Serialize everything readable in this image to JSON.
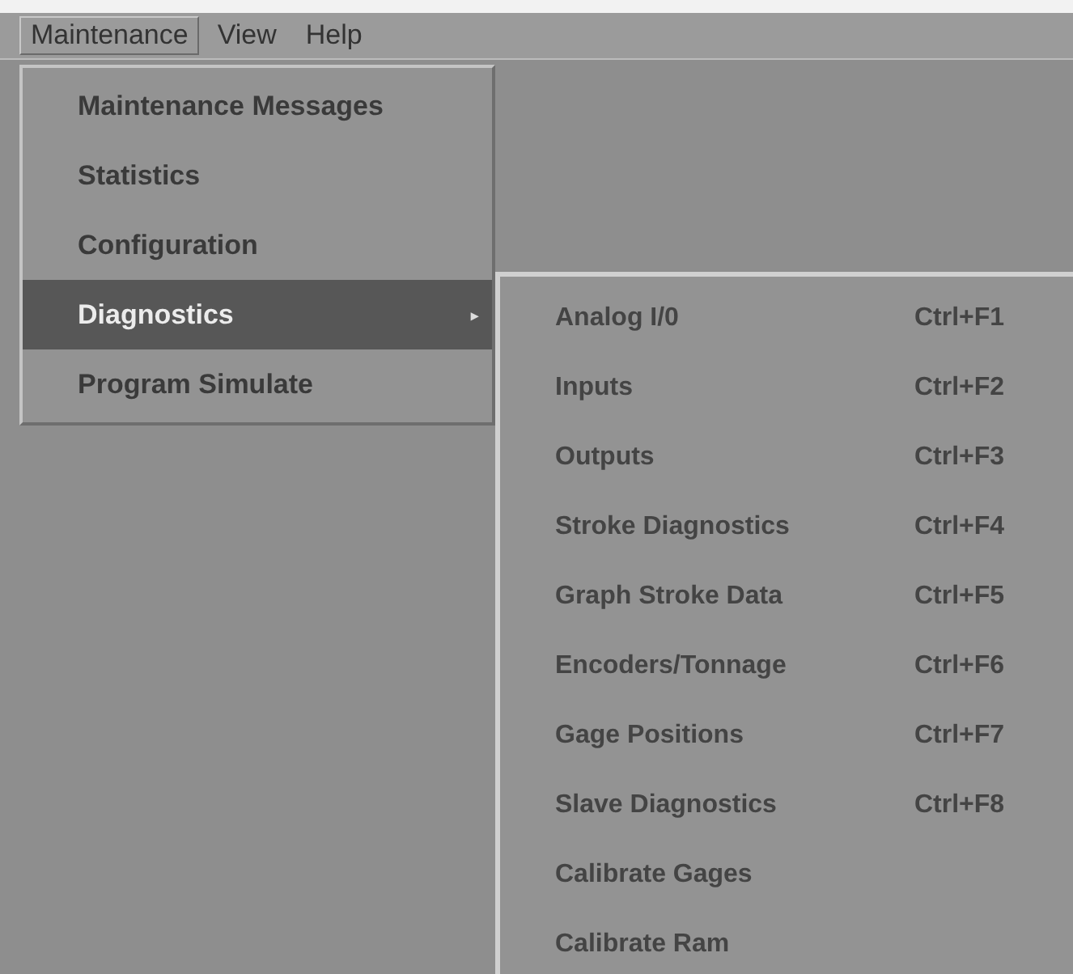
{
  "menubar": [
    {
      "label": "Maintenance",
      "selected": true
    },
    {
      "label": "View",
      "selected": false
    },
    {
      "label": "Help",
      "selected": false
    }
  ],
  "menu": [
    {
      "label": "Maintenance Messages",
      "selected": false
    },
    {
      "label": "Statistics",
      "selected": false
    },
    {
      "label": "Configuration",
      "selected": false
    },
    {
      "label": "Diagnostics",
      "selected": true,
      "arrow": "▸"
    },
    {
      "label": "Program Simulate",
      "selected": false
    }
  ],
  "submenu": [
    {
      "label": "Analog I/0",
      "shortcut": "Ctrl+F1"
    },
    {
      "label": "Inputs",
      "shortcut": "Ctrl+F2"
    },
    {
      "label": "Outputs",
      "shortcut": "Ctrl+F3"
    },
    {
      "label": "Stroke Diagnostics",
      "shortcut": "Ctrl+F4"
    },
    {
      "label": "Graph Stroke Data",
      "shortcut": "Ctrl+F5"
    },
    {
      "label": "Encoders/Tonnage",
      "shortcut": "Ctrl+F6"
    },
    {
      "label": "Gage Positions",
      "shortcut": "Ctrl+F7"
    },
    {
      "label": "Slave Diagnostics",
      "shortcut": "Ctrl+F8"
    },
    {
      "label": "Calibrate Gages"
    },
    {
      "label": "Calibrate Ram"
    }
  ]
}
